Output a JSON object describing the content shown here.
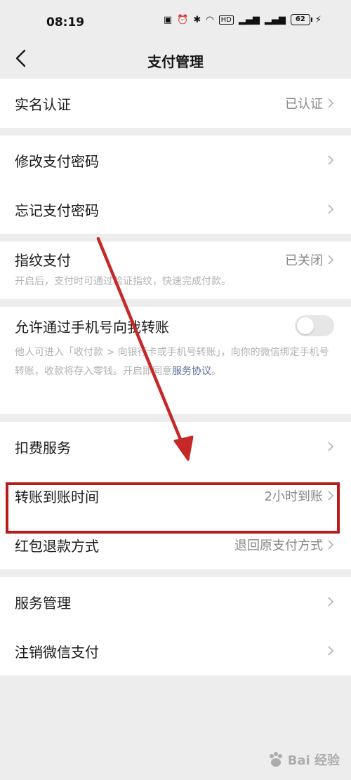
{
  "status": {
    "time": "08:19",
    "network": "HD",
    "battery": "62"
  },
  "nav": {
    "title": "支付管理"
  },
  "groups": [
    {
      "items": [
        {
          "label": "实名认证",
          "value": "已认证"
        }
      ]
    },
    {
      "items": [
        {
          "label": "修改支付密码"
        },
        {
          "label": "忘记支付密码"
        }
      ]
    },
    {
      "items": [
        {
          "label": "指纹支付",
          "value": "已关闭",
          "desc": "开启后，支付时可通过验证指纹，快速完成付款。"
        }
      ]
    },
    {
      "items": [
        {
          "label": "允许通过手机号向我转账",
          "desc": "他人可进入「收付款 > 向银行卡或手机号转账」，向你的微信绑定手机号转账，收款将存入零钱。开启即同意",
          "link": "服务协议",
          "desc_end": "。"
        }
      ]
    },
    {
      "items": [
        {
          "label": "扣费服务"
        },
        {
          "label": "转账到账时间",
          "value": "2小时到账"
        },
        {
          "label": "红包退款方式",
          "value": "退回原支付方式"
        }
      ]
    },
    {
      "items": [
        {
          "label": "服务管理"
        },
        {
          "label": "注销微信支付"
        }
      ]
    }
  ],
  "watermark": {
    "text": "Bai 经验"
  },
  "colors": {
    "background": "#ededed",
    "link": "#576b95",
    "highlight": "#b71c1c"
  }
}
